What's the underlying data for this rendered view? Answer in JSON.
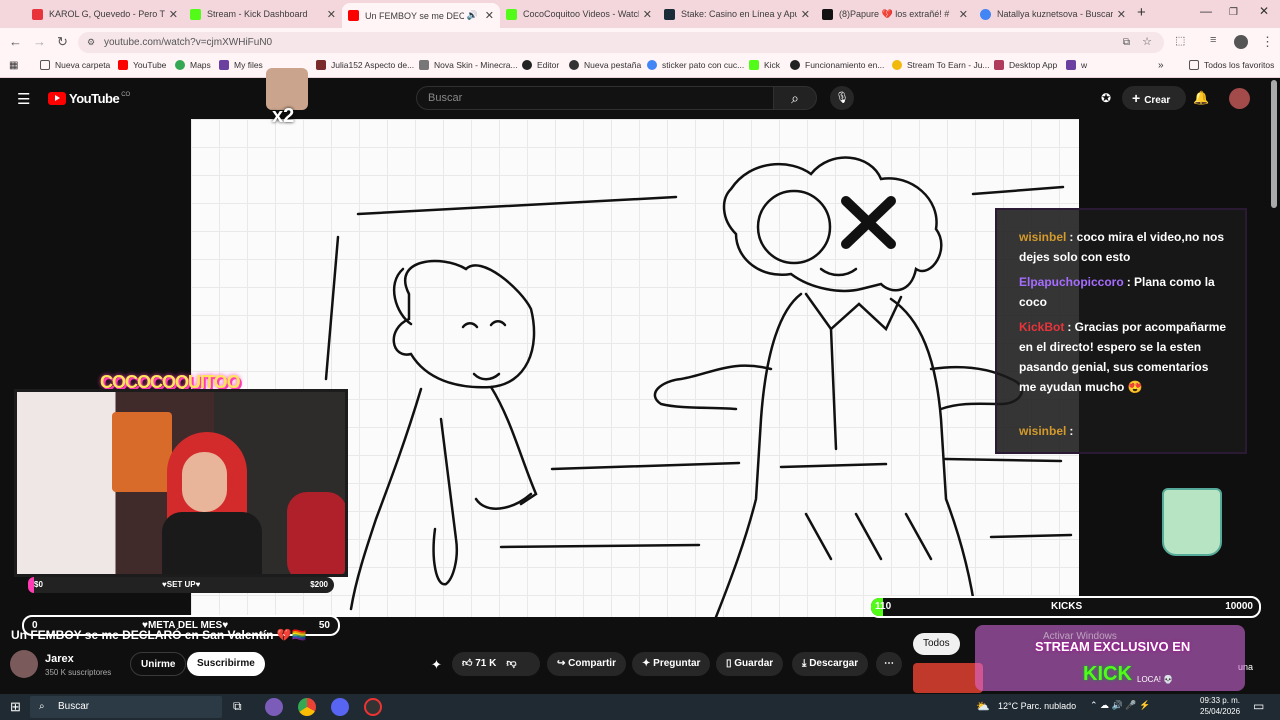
{
  "tabs": [
    {
      "title": "KAROL G, Quevedo - Pero Tú (L",
      "fav": "#e8343b"
    },
    {
      "title": "Stream - Kick Dashboard",
      "fav": "#53fc18"
    },
    {
      "title": "Un FEMBOY se me DECLAR",
      "fav": "#ff0000",
      "active": true
    },
    {
      "title": "CocoCoquitoo Videos - Watch",
      "fav": "#53fc18"
    },
    {
      "title": "Stake: Casino en Línea y Apue",
      "fav": "#1a2c38"
    },
    {
      "title": "(8)Papure 💔 los extrañé! #",
      "fav": "#111111"
    },
    {
      "title": "Natallya kuznetsova - Buscar c",
      "fav": "#4285f4"
    }
  ],
  "address": "youtube.com/watch?v=cjmXWHiFuN0",
  "bookmarks": [
    "Nueva carpeta",
    "YouTube",
    "Maps",
    "My files",
    "Julia152 Aspecto de...",
    "Nova Skin - Minecra...",
    "Editor",
    "Nueva pestaña",
    "sticker pato con cuc...",
    "Kick",
    "Funcionamiento en...",
    "Stream To Earn - Ju...",
    "Desktop App",
    "Todos los favoritos"
  ],
  "yt": {
    "logo": "YouTube",
    "logo_sup": "CO",
    "search_placeholder": "Buscar",
    "create": "Crear"
  },
  "overlay": {
    "title": "COCOCOQUITOO",
    "x2": "x2",
    "bar1_left": "$0",
    "bar1_mid": "♥SET UP♥",
    "bar1_right": "$200",
    "goal_left": "0",
    "goal_mid": "♥META DEL MES♥",
    "goal_right": "50",
    "kick_left": "110",
    "kick_mid": "KICKS",
    "kick_right": "10000",
    "promo_line1": "STREAM EXCLUSIVO EN",
    "promo_line2": "KICK",
    "watermark": "Activar Windows"
  },
  "chat": [
    {
      "user": "wisinbel",
      "text": ": coco mira el video,no nos dejes solo con esto",
      "color": "#d49a2b"
    },
    {
      "user": "Elpapuchopiccoro",
      "text": ": Plana como la coco",
      "color": "#a66cff"
    },
    {
      "user": "KickBot",
      "text": ": Gracias por acompañarme en el directo! espero se la esten pasando genial, sus comentarios me ayudan mucho 😍",
      "color": "#e8343b"
    },
    {
      "user": "wisinbel",
      "text": ":",
      "color": "#d49a2b"
    }
  ],
  "video": {
    "title": "Un FEMBOY se me DECLARÓ en San Valentín 💔🏳️‍🌈",
    "channel": "Jarex",
    "subs": "350 K suscriptores",
    "join": "Unirme",
    "subscribe": "Suscribirme",
    "likes": "71 K",
    "share": "Compartir",
    "ask": "Preguntar",
    "save": "Guardar",
    "download": "Descargar",
    "chip": "Todos",
    "sidebar_word": "una",
    "sidebar_sub": "LOCA! 💀"
  },
  "taskbar": {
    "search": "Buscar",
    "weather": "12°C  Parc. nublado",
    "time": "09:33 p. m.",
    "date": "25/04/2026"
  }
}
